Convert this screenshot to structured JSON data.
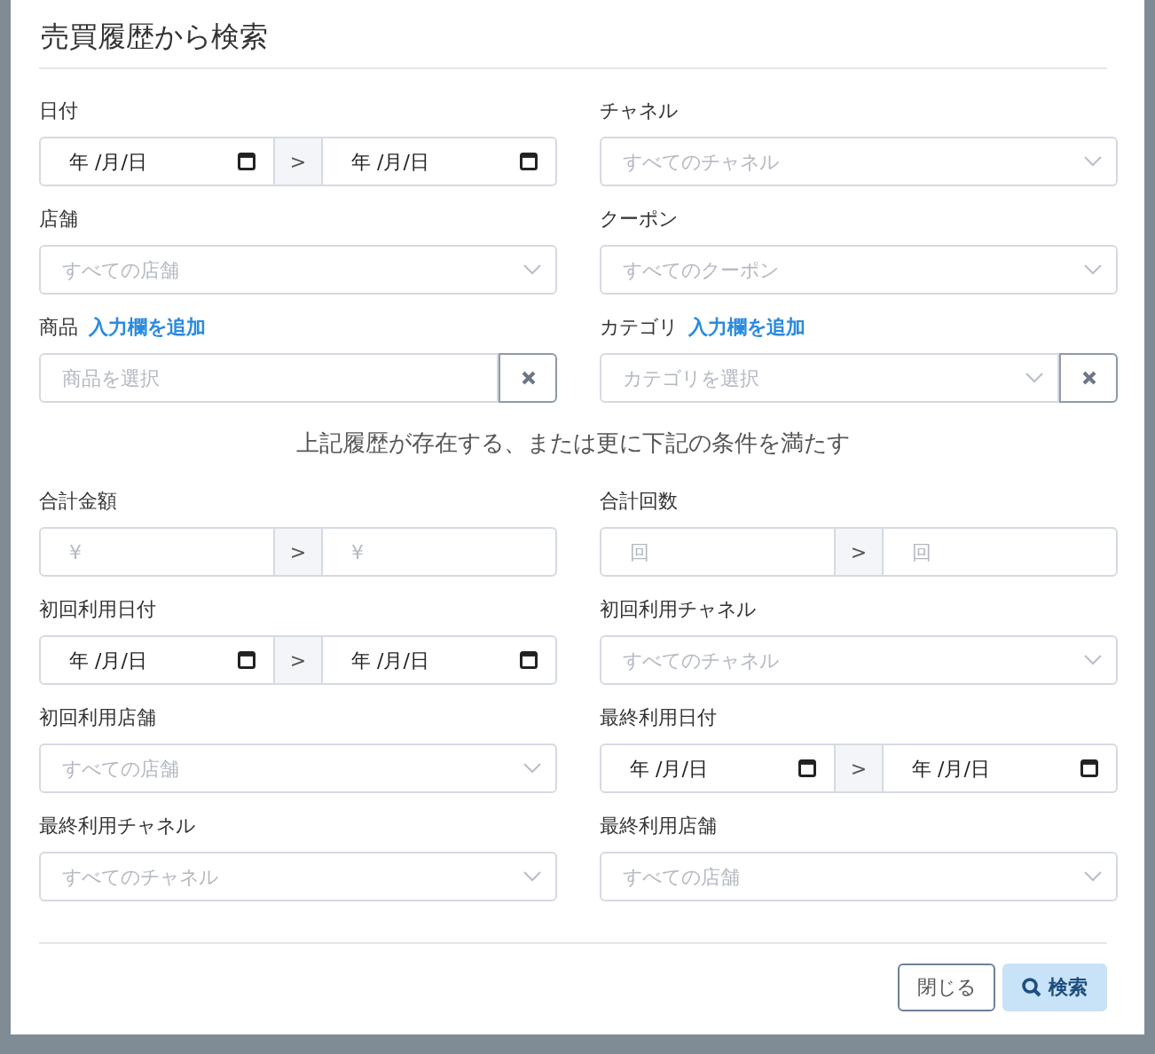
{
  "dialog": {
    "title": "売買履歴から検索"
  },
  "history_fields": [
    {
      "label": "日付",
      "kind": "date_range",
      "from": "年 /月/日",
      "separator": ">",
      "to": "年 /月/日"
    },
    {
      "label": "チャネル",
      "kind": "select",
      "placeholder": "すべてのチャネル"
    },
    {
      "label": "店舗",
      "kind": "select",
      "placeholder": "すべての店舗"
    },
    {
      "label": "クーポン",
      "kind": "select",
      "placeholder": "すべてのクーポン"
    },
    {
      "label": "商品",
      "link": "入力欄を追加",
      "kind": "input_clear",
      "placeholder": "商品を選択"
    },
    {
      "label": "カテゴリ",
      "link": "入力欄を追加",
      "kind": "select_clear",
      "placeholder": "カテゴリを選択"
    }
  ],
  "condition_note": "上記履歴が存在する、または更に下記の条件を満たす",
  "customer_fields": [
    {
      "label": "合計金額",
      "kind": "number_range",
      "from_placeholder": "¥",
      "separator": ">",
      "to_placeholder": "¥"
    },
    {
      "label": "合計回数",
      "kind": "number_range",
      "from_placeholder": "回",
      "separator": ">",
      "to_placeholder": "回"
    },
    {
      "label": "初回利用日付",
      "kind": "date_range",
      "from": "年 /月/日",
      "separator": ">",
      "to": "年 /月/日"
    },
    {
      "label": "初回利用チャネル",
      "kind": "select",
      "placeholder": "すべてのチャネル"
    },
    {
      "label": "初回利用店舗",
      "kind": "select",
      "placeholder": "すべての店舗"
    },
    {
      "label": "最終利用日付",
      "kind": "date_range",
      "from": "年 /月/日",
      "separator": ">",
      "to": "年 /月/日"
    },
    {
      "label": "最終利用チャネル",
      "kind": "select",
      "placeholder": "すべてのチャネル"
    },
    {
      "label": "最終利用店舗",
      "kind": "select",
      "placeholder": "すべての店舗"
    }
  ],
  "buttons": [
    {
      "label": "閉じる",
      "kind": "secondary"
    },
    {
      "label": "検索",
      "kind": "primary"
    }
  ]
}
